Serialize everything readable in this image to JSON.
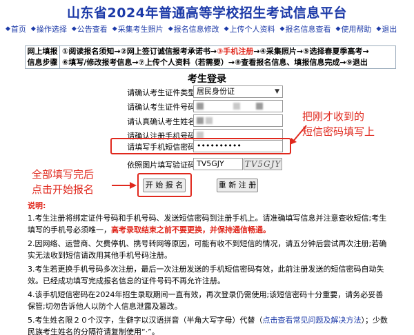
{
  "title": "山东省2024年普通高等学校招生考试信息平台",
  "nav": [
    {
      "name": "nav-home",
      "label": "首页"
    },
    {
      "name": "nav-operation",
      "label": "操作选择"
    },
    {
      "name": "nav-announcement",
      "label": "公告查看"
    },
    {
      "name": "nav-photo",
      "label": "采集考生照片"
    },
    {
      "name": "nav-modify",
      "label": "报名信息修改"
    },
    {
      "name": "nav-upload",
      "label": "上传个人资料"
    },
    {
      "name": "nav-view",
      "label": "报名信息查看"
    },
    {
      "name": "nav-help",
      "label": "使用帮助"
    },
    {
      "name": "nav-logout",
      "label": "退出"
    }
  ],
  "steps": {
    "label_line1": "网上填报",
    "label_line2": "信息步骤",
    "line1_a": "①阅读报名须知→②网上签订诚信报考承诺书→",
    "line1_current": "③手机注册",
    "line1_b": "→④采集照片→⑤选择春夏季高考→",
    "line2": "⑥填写/修改报考信息→⑦上传个人资料（若需要）→⑧查看报名信息、填报信息完成→⑨退出"
  },
  "form": {
    "title": "考生登录",
    "id_type_label": "请确认考生证件类型:",
    "id_type_value": "居民身份证",
    "id_number_label": "请确认考生证件号码:",
    "name_label": "请认真确认考生姓名:",
    "phone_label": "请确认注册手机号码:",
    "sms_label": "请填写手机短信密码:",
    "sms_value": "••••••••••",
    "captcha_label": "依照图片填写验证码:",
    "captcha_value": "TV5GJY",
    "captcha_image_text": "TV5GJY",
    "register_button": "开 始 报 名",
    "reregister_button": "重 新 注 册"
  },
  "annotations": {
    "right_line1": "把刚才收到的",
    "right_line2": "短信密码填写上",
    "left_line1": "全部填写完后",
    "left_line2": "点击开始报名"
  },
  "notes": {
    "heading": "说明:",
    "n1_a": "1.考生注册将绑定证件号码和手机号码、发送短信密码到注册手机上。请准确填写信息并注意查收短信;考生填写的手机号必须唯一，",
    "n1_red": "高考录取结束之前不要更换，并保持通信畅通。",
    "n2": "2.因网络、运营商、欠费停机、携号转网等原因，可能有收不到短信的情况，请五分钟后尝试再次注册;若确实无法收到短信请改用其他手机号码注册。",
    "n3": "3.考生若更换手机号码多次注册，最后一次注册发送的手机短信密码有效，此前注册发送的短信密码自动失效。已经成功填写完成报名信息的证件号码不再允许注册。",
    "n4": "4.该手机短信密码在2024年招生录取期间一直有效，再次登录仍需使用;该短信密码十分重要，请务必妥善保管;切勿告诉他人以防个人信息泄露及篡改。",
    "n5_a": "5.考生姓名限２０个汉字，生僻字以汉语拼音（半角大写字母）代替（",
    "n5_link": "点击查看常见问题及解决方法",
    "n5_b": "）；少数民族考生姓名的分隔符请复制使用“·”。"
  },
  "colors": {
    "title_blue": "#1c3aa8",
    "annotation_red": "#e0281d"
  }
}
